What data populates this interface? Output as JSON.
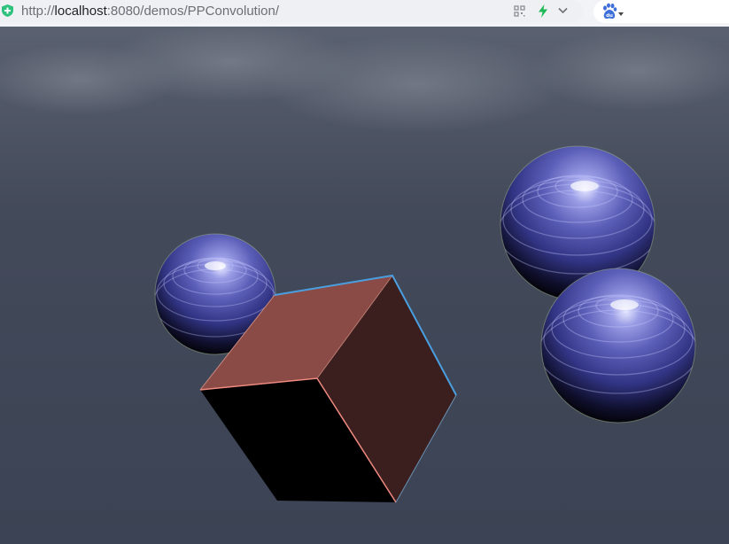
{
  "browser": {
    "url_prefix": "http://",
    "url_host": "localhost",
    "url_rest": ":8080/demos/PPConvolution/",
    "icons": {
      "site": "shield-plus-icon",
      "qr": "qr-code-icon",
      "speed": "lightning-bolt-icon",
      "dropdown": "chevron-down-icon",
      "search_engine": "baidu-paw-icon"
    }
  },
  "scene": {
    "background_color": "#3d4556",
    "sky_color": "#4b5363",
    "sphere_color": "#4b4ea6",
    "cube_top_color": "#8a4a45",
    "cube_side_color": "#3b1f1f",
    "cube_front_color": "#000000"
  }
}
